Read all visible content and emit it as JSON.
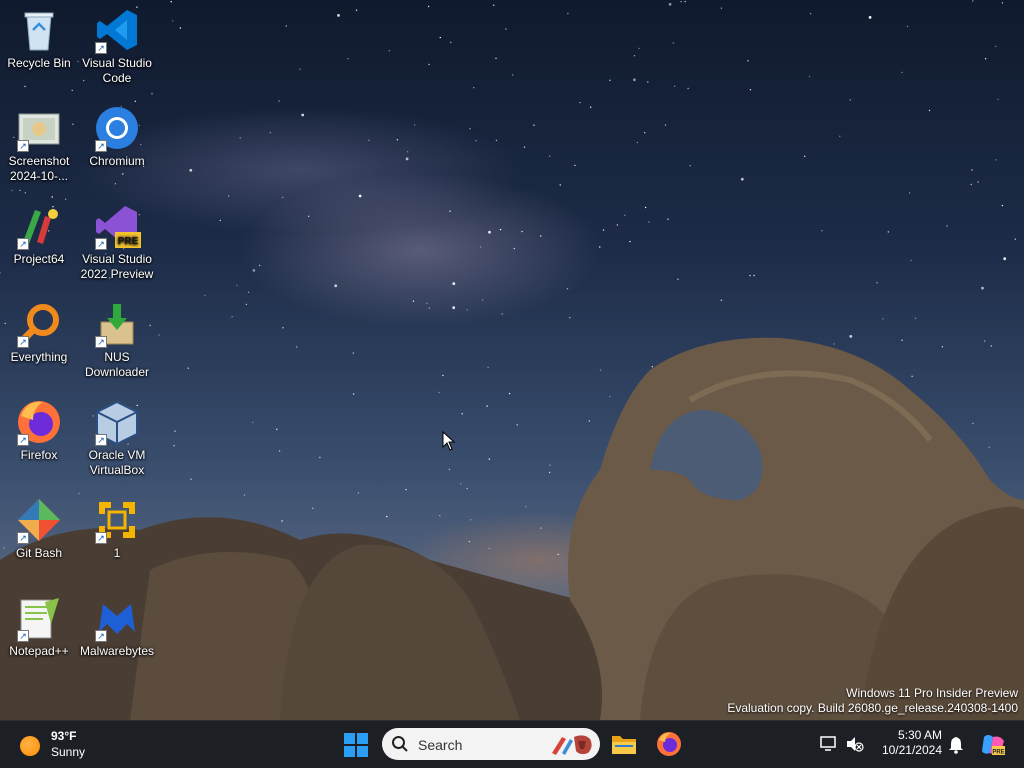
{
  "desktop": {
    "icons": [
      {
        "label": "Recycle Bin",
        "icon": "recycle-bin-icon"
      },
      {
        "label": "Visual Studio Code",
        "icon": "vscode-icon"
      },
      {
        "label": "Screenshot 2024-10-...",
        "icon": "screenshot-file-icon"
      },
      {
        "label": "Chromium",
        "icon": "chromium-icon"
      },
      {
        "label": "Project64",
        "icon": "project64-icon"
      },
      {
        "label": "Visual Studio 2022 Preview",
        "icon": "visual-studio-preview-icon",
        "badge": "PRE"
      },
      {
        "label": "Everything",
        "icon": "everything-search-icon"
      },
      {
        "label": "NUS Downloader",
        "icon": "nus-downloader-icon"
      },
      {
        "label": "Firefox",
        "icon": "firefox-icon"
      },
      {
        "label": "Oracle VM VirtualBox",
        "icon": "virtualbox-icon"
      },
      {
        "label": "Git Bash",
        "icon": "git-bash-icon"
      },
      {
        "label": "1",
        "icon": "vmware-icon"
      },
      {
        "label": "Notepad++",
        "icon": "notepad-plus-plus-icon"
      },
      {
        "label": "Malwarebytes",
        "icon": "malwarebytes-icon"
      }
    ],
    "watermark": {
      "line1": "Windows 11 Pro Insider Preview",
      "line2": "Evaluation copy. Build 26080.ge_release.240308-1400"
    }
  },
  "taskbar": {
    "weather": {
      "temp": "93°F",
      "condition": "Sunny",
      "icon": "sun-icon"
    },
    "search": {
      "placeholder": "Search"
    },
    "pinned": [
      "start-icon",
      "file-explorer-icon",
      "firefox-icon"
    ],
    "tray": {
      "time": "5:30 AM",
      "date": "10/21/2024"
    }
  },
  "colors": {
    "taskbar_bg": "#1c1f24",
    "vscode_blue": "#0078d4",
    "vs_purple": "#8c52d6",
    "start_blue": "#2a9df4"
  }
}
